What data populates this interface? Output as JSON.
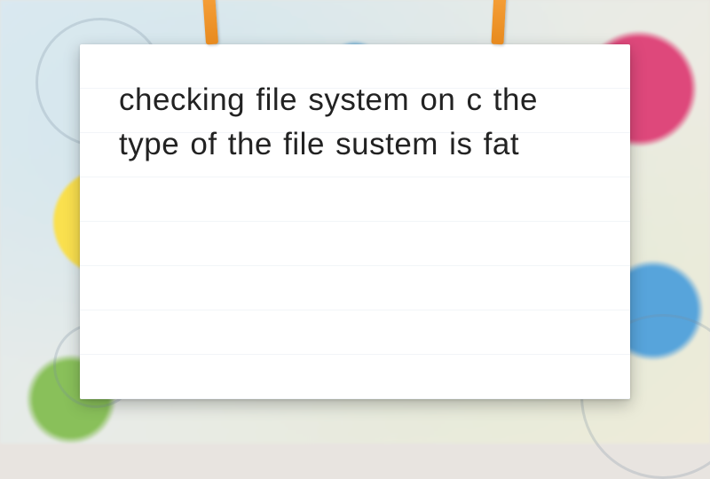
{
  "question": {
    "text": "checking file system on c the type of the file sustem is fat"
  }
}
